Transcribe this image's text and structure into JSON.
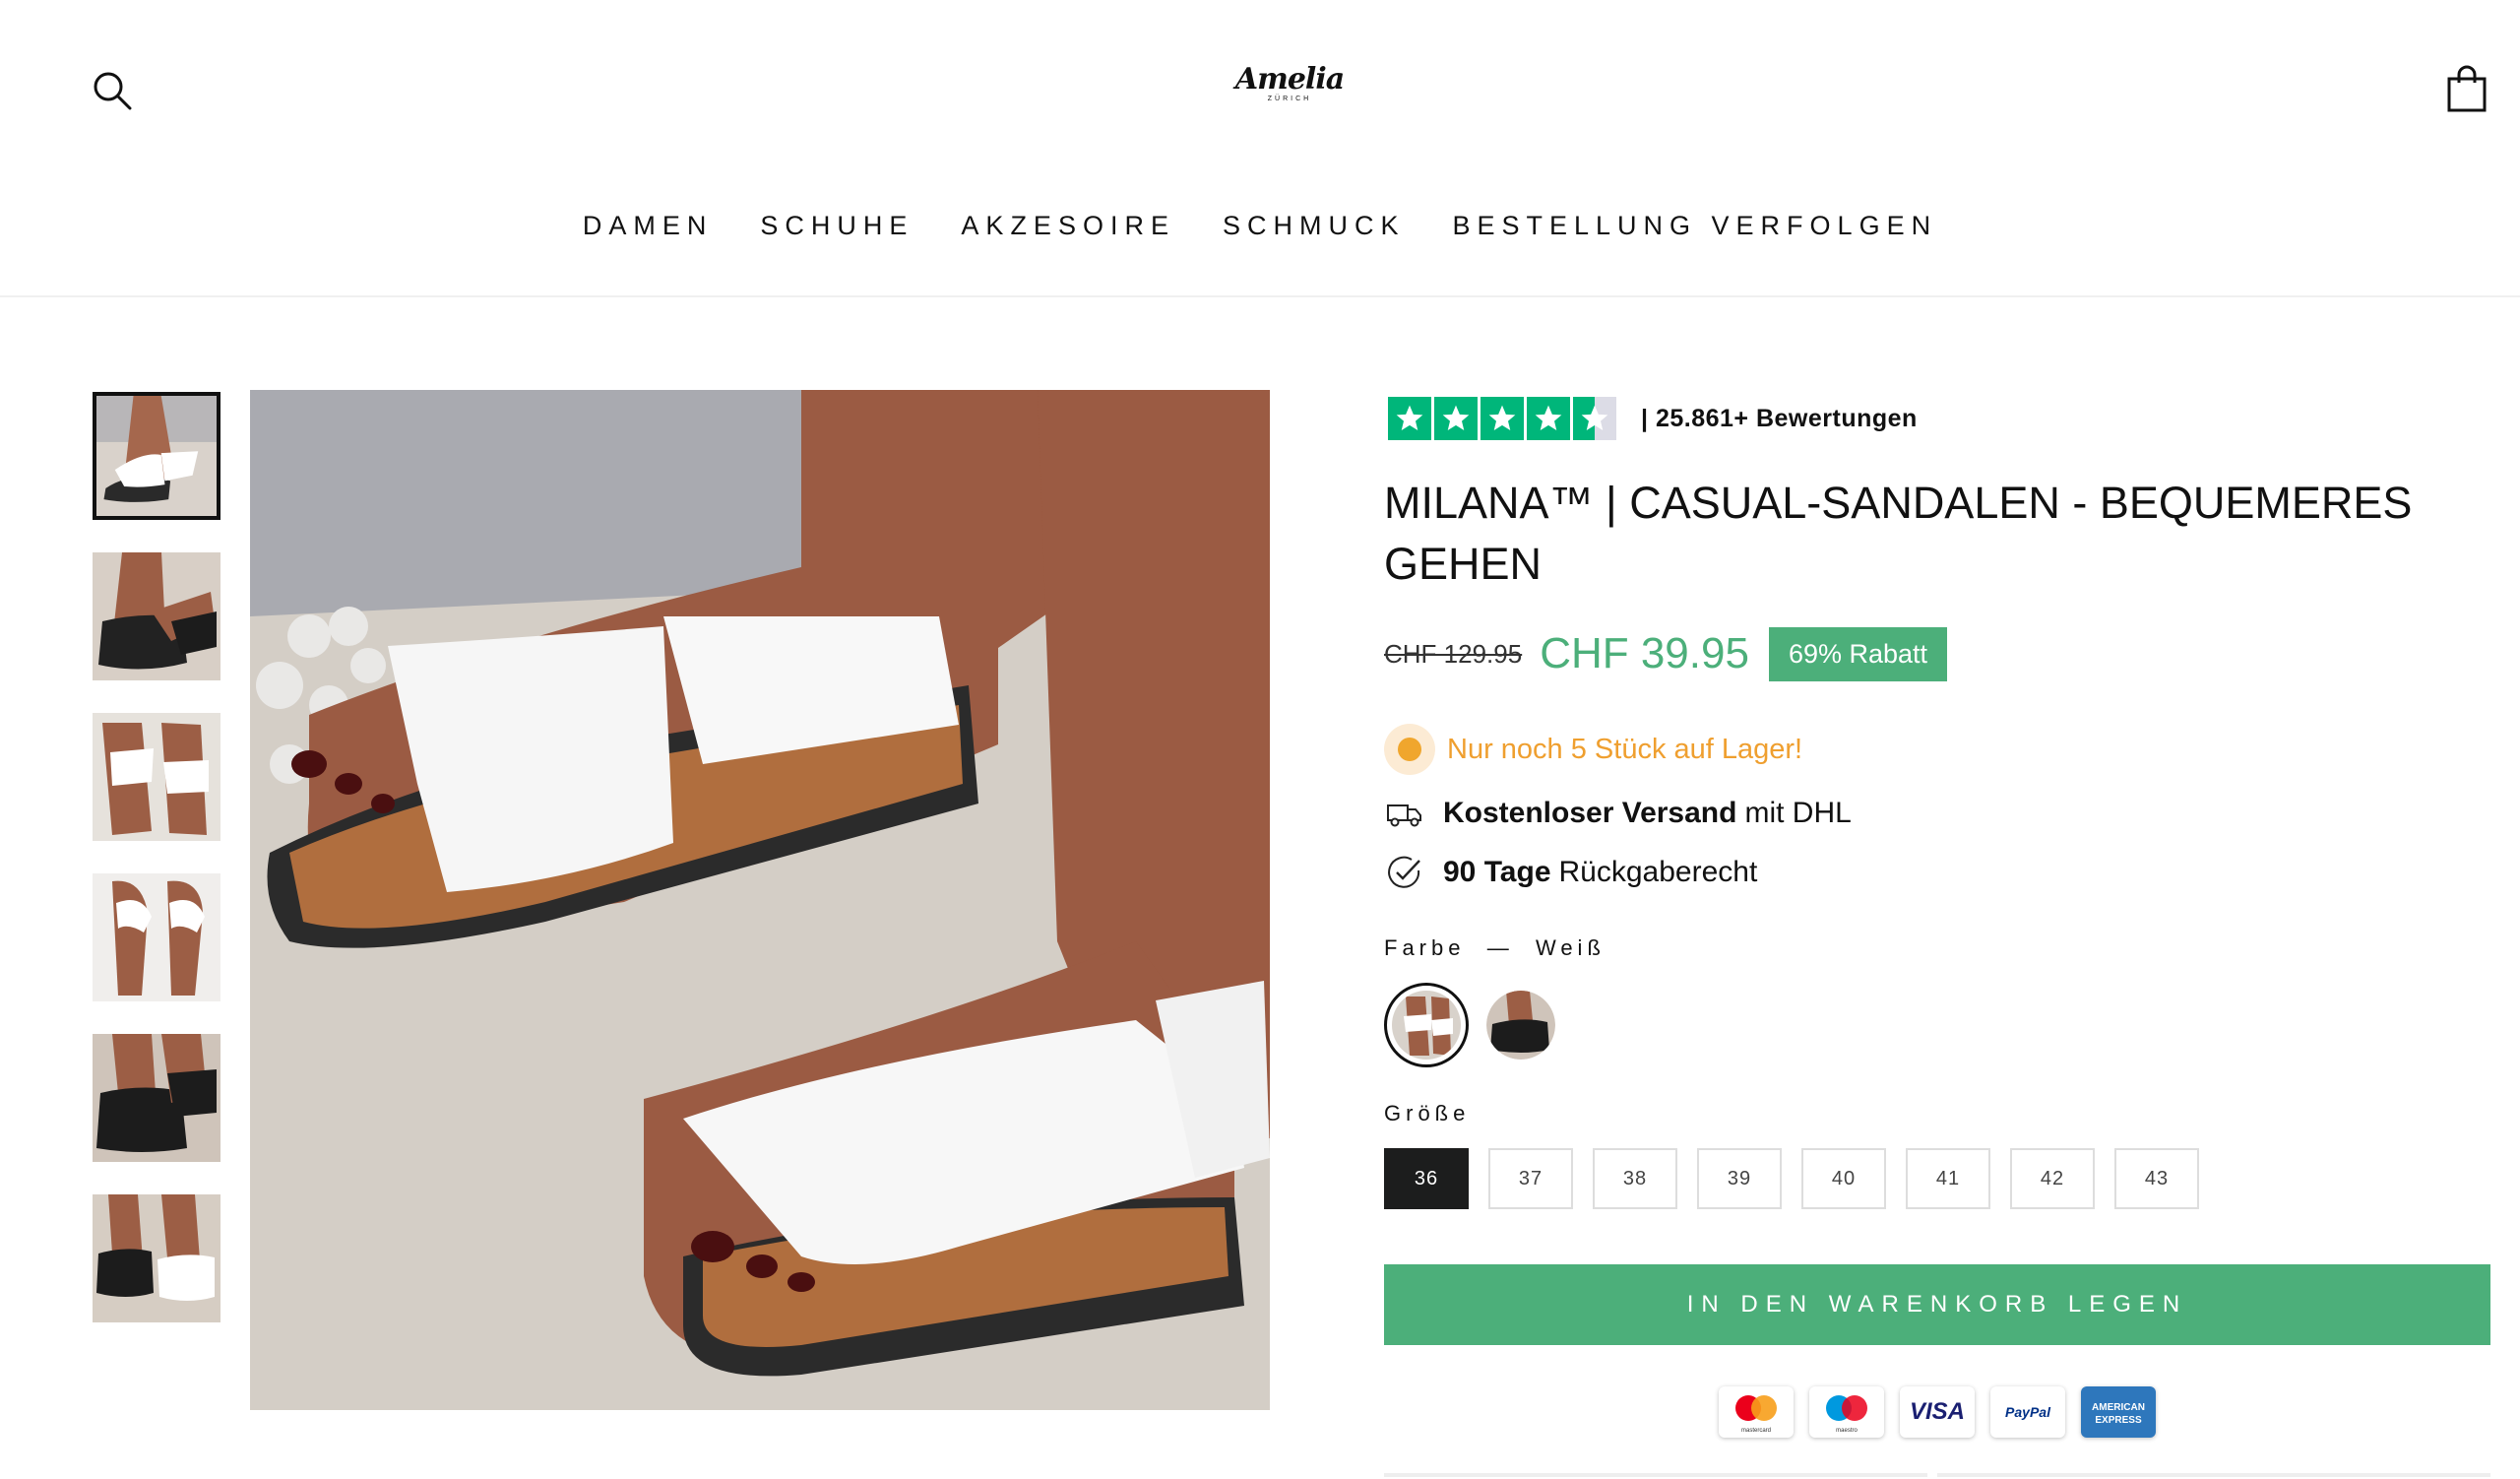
{
  "header": {
    "logo_name": "Amelia",
    "logo_sub": "ZÜRICH",
    "search_icon": "search-icon",
    "cart_icon": "shopping-bag-icon"
  },
  "nav": [
    "DAMEN",
    "SCHUHE",
    "AKZESOIRE",
    "SCHMUCK",
    "BESTELLUNG VERFOLGEN"
  ],
  "gallery": {
    "thumbnail_count": 6,
    "active_index": 0
  },
  "product": {
    "rating_stars": 4.5,
    "rating_text": "| 25.861+ Bewertungen",
    "title": "MILANA™ | CASUAL-SANDALEN - BEQUEMERES GEHEN",
    "old_price": "CHF 129.95",
    "price": "CHF 39.95",
    "discount": "69% Rabatt",
    "stock": "Nur noch 5 Stück auf Lager!",
    "shipping_bold": "Kostenloser Versand",
    "shipping_rest": "mit DHL",
    "returns_bold": "90 Tage",
    "returns_rest": "Rückgaberecht",
    "color_label": "Farbe",
    "color_sep": "—",
    "color_value": "Weiß",
    "colors": [
      "Weiß",
      "Schwarz"
    ],
    "size_label": "Größe",
    "sizes": [
      "36",
      "37",
      "38",
      "39",
      "40",
      "41",
      "42",
      "43"
    ],
    "selected_size": "36",
    "add_to_cart": "IN DEN WARENKORB LEGEN"
  },
  "payments": {
    "mastercard": "mastercard",
    "maestro": "maestro",
    "visa": "VISA",
    "paypal": "PayPal",
    "amex_1": "AMERICAN",
    "amex_2": "EXPRESS"
  },
  "colors": {
    "accent": "#4caf7a",
    "stock": "#ef9f2f",
    "trustpilot": "#00b67a",
    "dark": "#1c1d1d"
  }
}
